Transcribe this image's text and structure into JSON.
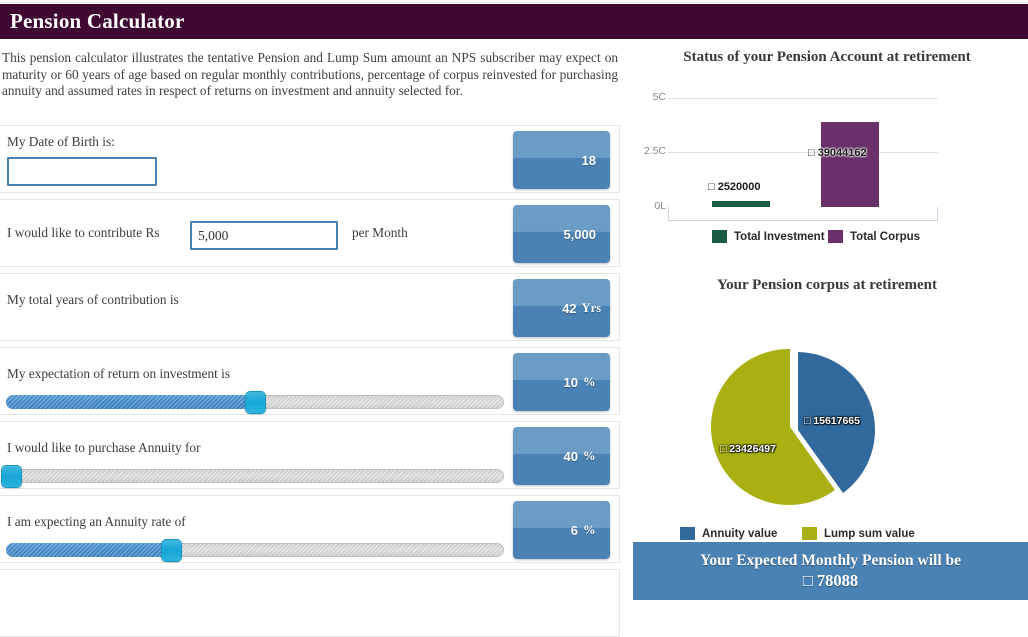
{
  "header": {
    "title": "Pension Calculator"
  },
  "intro": {
    "text": "This pension calculator illustrates the tentative Pension and Lump Sum amount an NPS subscriber may expect on maturity or 60 years of age based on regular monthly contributions, percentage of corpus reinvested for purchasing annuity and assumed rates in respect of returns on investment and annuity selected for."
  },
  "form": {
    "rows": [
      {
        "label": "My Date of Birth is:",
        "control": "date-input",
        "input_value": "",
        "input_placeholder": "",
        "suffix": "",
        "badge_value": "18",
        "badge_unit": ""
      },
      {
        "label": "I would like to contribute Rs",
        "control": "text-input",
        "input_value": "5,000",
        "input_placeholder": "",
        "suffix": "per Month",
        "badge_value": "5,000",
        "badge_unit": ""
      },
      {
        "label": "My total years of contribution is",
        "control": "none",
        "badge_value": "42",
        "badge_unit": "Yrs"
      },
      {
        "label": "My expectation of return on investment is",
        "control": "slider",
        "slider_percent": 50,
        "badge_value": "10",
        "badge_unit": "%"
      },
      {
        "label": "I would like to purchase Annuity for",
        "control": "slider",
        "slider_percent": 2,
        "badge_value": "40",
        "badge_unit": "%"
      },
      {
        "label": "I am expecting an Annuity rate of",
        "control": "slider",
        "slider_percent": 33,
        "badge_value": "6",
        "badge_unit": "%"
      }
    ]
  },
  "colors": {
    "header_purple": "#3f0832",
    "badge_blue": "#4b82b4",
    "banner_blue": "#4b82b4",
    "bar_investment_green": "#1a5c40",
    "bar_corpus_purple": "#693069",
    "pie_annuity_blue": "#31699c",
    "pie_lumpsum_olive": "#aab012",
    "slider_fill": "#3f87c6",
    "slider_handle": "#18a6d6"
  },
  "chart_data": [
    {
      "type": "bar",
      "title": "Status of your Pension Account at retirement",
      "categories": [
        "Total Investment",
        "Total Corpus"
      ],
      "series": [
        {
          "name": "Total Investment",
          "values": [
            2520000
          ],
          "color": "#1a5c40"
        },
        {
          "name": "Total Corpus",
          "values": [
            39044162
          ],
          "color": "#693069"
        }
      ],
      "data_labels": [
        "□ 2520000",
        "□ 39044162"
      ],
      "values": [
        2520000,
        39044162
      ],
      "yticks": [
        "0L",
        "2.5C",
        "5C"
      ],
      "ytick_values": [
        0,
        25000000,
        50000000
      ],
      "ylim": [
        0,
        50000000
      ],
      "xlabel": "",
      "ylabel": "",
      "grid": true,
      "legend": [
        "Total Investment",
        "Total Corpus"
      ],
      "legend_position": "bottom"
    },
    {
      "type": "pie",
      "title": "Your Pension corpus at retirement",
      "labels": [
        "Annuity value",
        "Lump sum value"
      ],
      "values": [
        15617665,
        23426497
      ],
      "data_labels": [
        "□ 15617665",
        "□ 23426497"
      ],
      "percentages": [
        40,
        60
      ],
      "colors": [
        "#31699c",
        "#aab012"
      ],
      "legend": [
        "Annuity value",
        "Lump sum value"
      ],
      "legend_position": "bottom",
      "exploded": true
    }
  ],
  "banner": {
    "line1": "Your Expected Monthly Pension will be",
    "line2": "□ 78088"
  }
}
